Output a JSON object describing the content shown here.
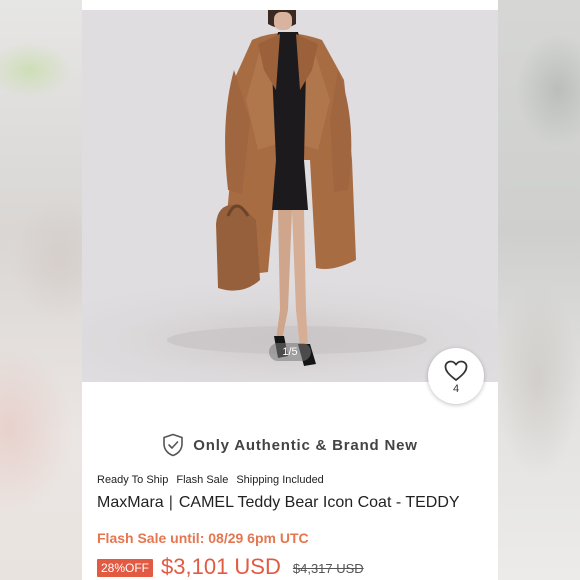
{
  "gallery": {
    "counter": "1/5"
  },
  "like": {
    "count": "4",
    "icon": "heart-outline-icon"
  },
  "authenticity": {
    "icon": "shield-check-icon",
    "text": "Only Authentic & Brand New"
  },
  "tags": [
    "Ready To Ship",
    "Flash Sale",
    "Shipping Included"
  ],
  "product": {
    "brand": "MaxMara",
    "separator": "|",
    "name": "CAMEL Teddy Bear Icon Coat - TEDDY"
  },
  "flash_sale": {
    "text": "Flash Sale until: 08/29 6pm UTC"
  },
  "pricing": {
    "discount_badge": "28%OFF",
    "price": "$3,101 USD",
    "original_price": "$4,317 USD"
  },
  "colors": {
    "accent": "#e35a43",
    "flash_text": "#e5764f",
    "coat": "#a86c43"
  }
}
